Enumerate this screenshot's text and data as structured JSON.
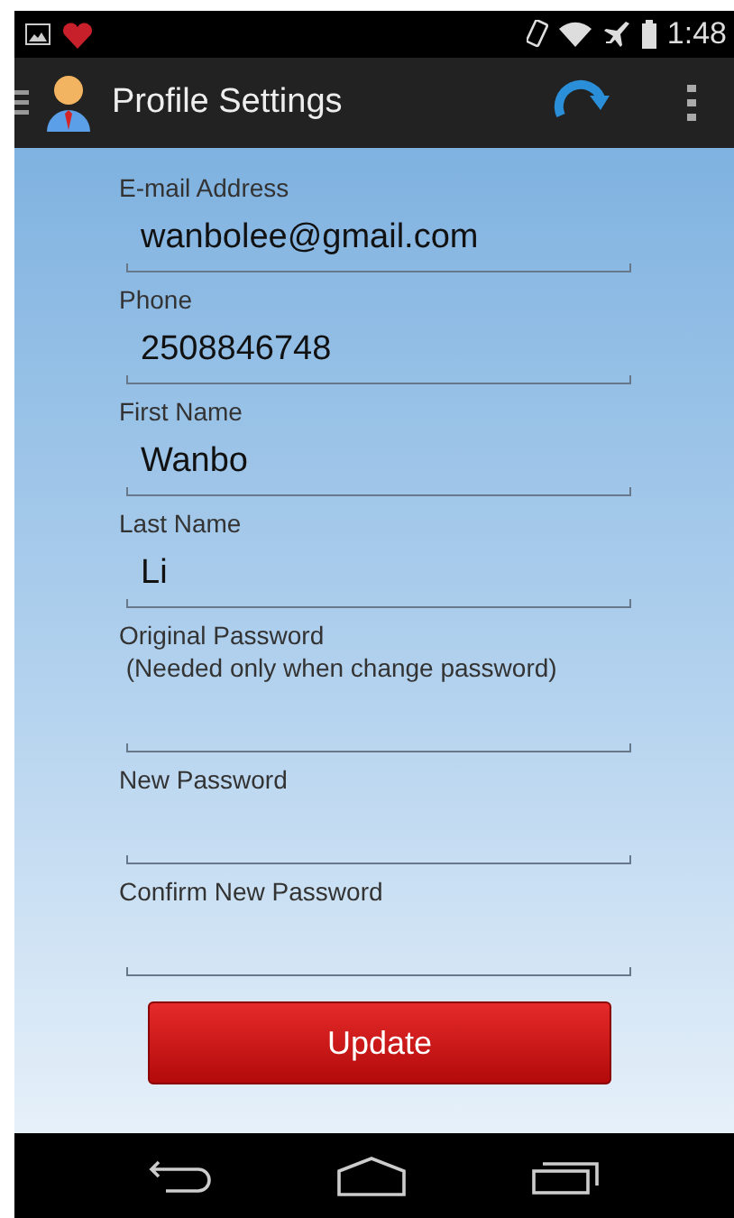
{
  "status_bar": {
    "time": "1:48"
  },
  "app_bar": {
    "title": "Profile Settings"
  },
  "fields": [
    {
      "label": "E-mail Address",
      "value": "wanbolee@gmail.com"
    },
    {
      "label": "Phone",
      "value": "2508846748"
    },
    {
      "label": "First Name",
      "value": "Wanbo"
    },
    {
      "label": "Last Name",
      "value": "Li"
    },
    {
      "label": "Original Password",
      "note": " (Needed only when change password)"
    },
    {
      "label": "New Password"
    },
    {
      "label": "Confirm New Password"
    }
  ],
  "button": {
    "label": "Update"
  }
}
